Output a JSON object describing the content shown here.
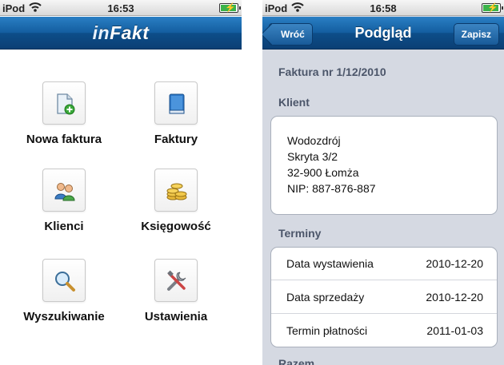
{
  "left": {
    "status": {
      "carrier": "iPod",
      "time": "16:53"
    },
    "logo": {
      "in": "in",
      "fakt": "Fakt"
    },
    "menu": [
      {
        "label": "Nowa faktura",
        "icon": "new-invoice-icon"
      },
      {
        "label": "Faktury",
        "icon": "book-icon"
      },
      {
        "label": "Klienci",
        "icon": "users-icon"
      },
      {
        "label": "Księgowość",
        "icon": "coins-icon"
      },
      {
        "label": "Wyszukiwanie",
        "icon": "magnifier-icon"
      },
      {
        "label": "Ustawienia",
        "icon": "tools-icon"
      }
    ]
  },
  "right": {
    "status": {
      "carrier": "iPod",
      "time": "16:58"
    },
    "nav": {
      "back": "Wróć",
      "title": "Podgląd",
      "save": "Zapisz"
    },
    "invoice_title": "Faktura nr 1/12/2010",
    "client_header": "Klient",
    "client_lines": [
      "Wodozdrój",
      "Skryta 3/2",
      "32-900 Łomża",
      "NIP: 887-876-887"
    ],
    "terms_header": "Terminy",
    "terms": [
      {
        "label": "Data wystawienia",
        "value": "2010-12-20"
      },
      {
        "label": "Data sprzedaży",
        "value": "2010-12-20"
      },
      {
        "label": "Termin płatności",
        "value": "2011-01-03"
      }
    ],
    "next_header": "Razem"
  },
  "colors": {
    "navbar": "#135d9f",
    "section_text": "#4c566a",
    "background_grouped": "#d5d9e2"
  }
}
